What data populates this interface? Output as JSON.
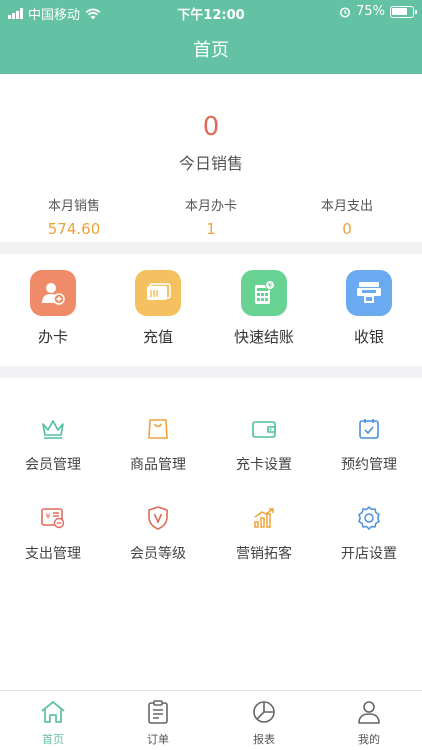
{
  "status_bar": {
    "carrier": "中国移动",
    "time": "下午12:00",
    "battery": "75%"
  },
  "header": {
    "title": "首页"
  },
  "today": {
    "value": "0",
    "label": "今日销售"
  },
  "month_stats": [
    {
      "label": "本月销售",
      "value": "574.60"
    },
    {
      "label": "本月办卡",
      "value": "1"
    },
    {
      "label": "本月支出",
      "value": "0"
    }
  ],
  "quick_actions": [
    {
      "label": "办卡",
      "icon": "add-user-icon",
      "color": "#ef8b68"
    },
    {
      "label": "充值",
      "icon": "card-stack-icon",
      "color": "#f5c05f"
    },
    {
      "label": "快速结账",
      "icon": "calculator-icon",
      "color": "#67d291"
    },
    {
      "label": "收银",
      "icon": "cash-register-icon",
      "color": "#6aaaf0"
    }
  ],
  "menu": [
    {
      "label": "会员管理",
      "icon": "crown-icon",
      "color": "#4dbfa0"
    },
    {
      "label": "商品管理",
      "icon": "shopping-bag-icon",
      "color": "#f0a23a"
    },
    {
      "label": "充卡设置",
      "icon": "wallet-icon",
      "color": "#4dbfa0"
    },
    {
      "label": "预约管理",
      "icon": "calendar-check-icon",
      "color": "#4a90d9"
    },
    {
      "label": "支出管理",
      "icon": "expense-card-icon",
      "color": "#e06b5a"
    },
    {
      "label": "会员等级",
      "icon": "shield-v-icon",
      "color": "#e06b5a"
    },
    {
      "label": "营销拓客",
      "icon": "growth-chart-icon",
      "color": "#f0a23a"
    },
    {
      "label": "开店设置",
      "icon": "gear-icon",
      "color": "#4a90d9"
    }
  ],
  "tabs": [
    {
      "label": "首页",
      "icon": "home-icon",
      "active": true
    },
    {
      "label": "订单",
      "icon": "clipboard-icon",
      "active": false
    },
    {
      "label": "报表",
      "icon": "pie-chart-icon",
      "active": false
    },
    {
      "label": "我的",
      "icon": "person-icon",
      "active": false
    }
  ]
}
